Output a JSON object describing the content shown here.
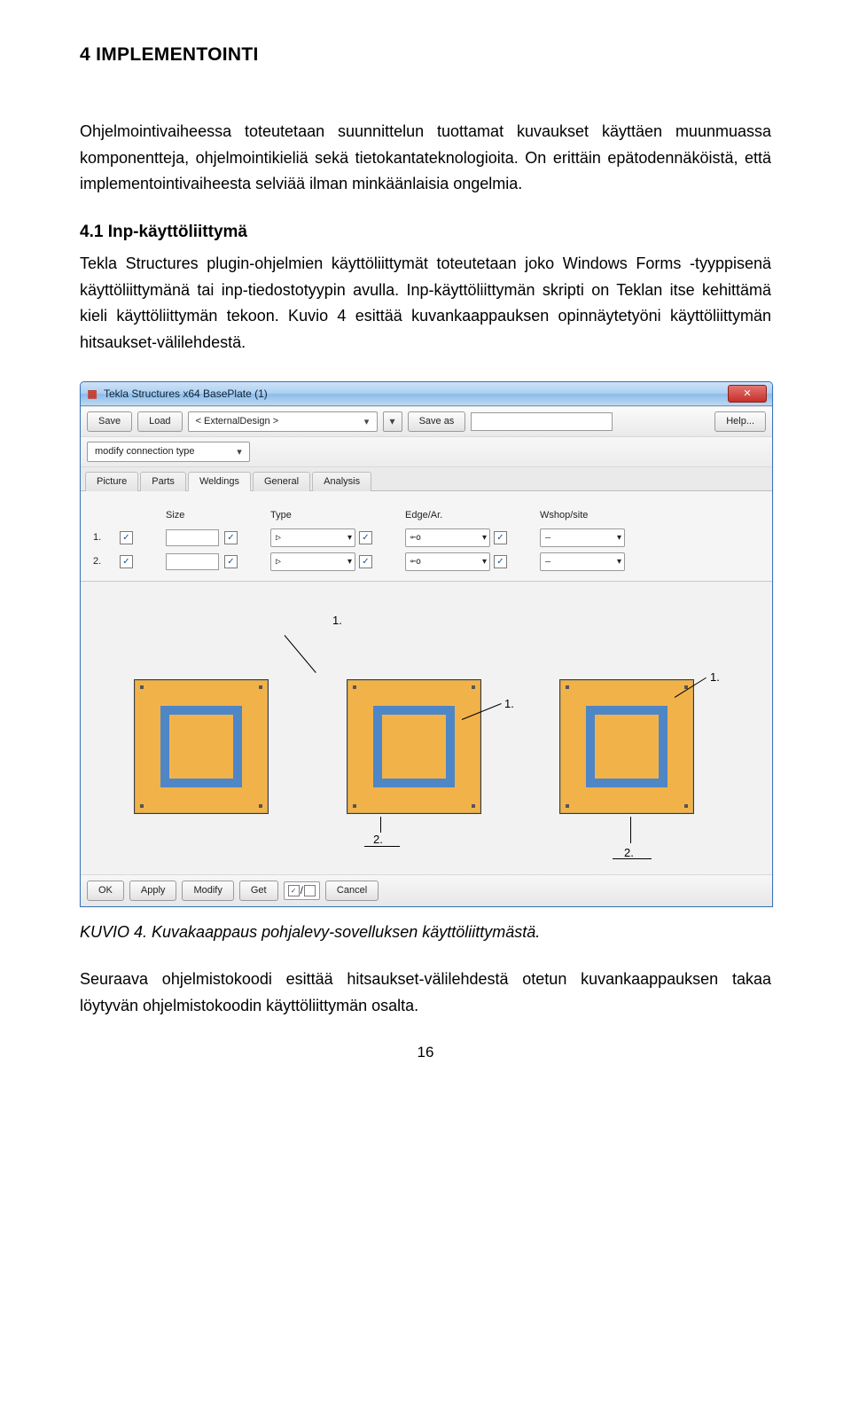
{
  "doc": {
    "h2": "4 IMPLEMENTOINTI",
    "p1": "Ohjelmointivaiheessa toteutetaan suunnittelun tuottamat kuvaukset käyttäen muunmuassa komponentteja, ohjelmointikieliä sekä tietokantateknologioita. On erittäin epätodennäköistä, että implementointivaiheesta selviää ilman minkäänlaisia ongelmia.",
    "h3": "4.1 Inp-käyttöliittymä",
    "p2": "Tekla Structures plugin-ohjelmien käyttöliittymät toteutetaan joko Windows Forms -tyyppisenä käyttöliittymänä tai inp-tiedostotyypin avulla. Inp-käyttöliittymän skripti on Teklan itse kehittämä kieli käyttöliittymän tekoon. Kuvio 4 esittää kuvankaappauksen opinnäytetyöni käyttöliittymän hitsaukset-välilehdestä.",
    "caption": "KUVIO 4. Kuvakaappaus pohjalevy-sovelluksen käyttöliittymästä.",
    "p3": "Seuraava ohjelmistokoodi esittää hitsaukset-välilehdestä otetun kuvankaappauksen takaa löytyvän ohjelmistokoodin käyttöliittymän osalta.",
    "pagenum": "16"
  },
  "win": {
    "title": "Tekla Structures x64  BasePlate (1)",
    "close": "✕",
    "toolbar1": {
      "save": "Save",
      "load": "Load",
      "designCombo": "< ExternalDesign >",
      "saveas": "Save as",
      "help": "Help..."
    },
    "toolbar2": {
      "modifyConn": "modify connection type"
    },
    "tabs": [
      "Picture",
      "Parts",
      "Weldings",
      "General",
      "Analysis"
    ],
    "activeTab": 2,
    "headers": {
      "size": "Size",
      "type": "Type",
      "edge": "Edge/Ar.",
      "wshop": "Wshop/site"
    },
    "rows": [
      {
        "num": "1."
      },
      {
        "num": "2."
      }
    ],
    "picLabels": {
      "one": "1.",
      "two": "2."
    },
    "footer": {
      "ok": "OK",
      "apply": "Apply",
      "modify": "Modify",
      "get": "Get",
      "cancel": "Cancel",
      "slash": "/"
    }
  }
}
